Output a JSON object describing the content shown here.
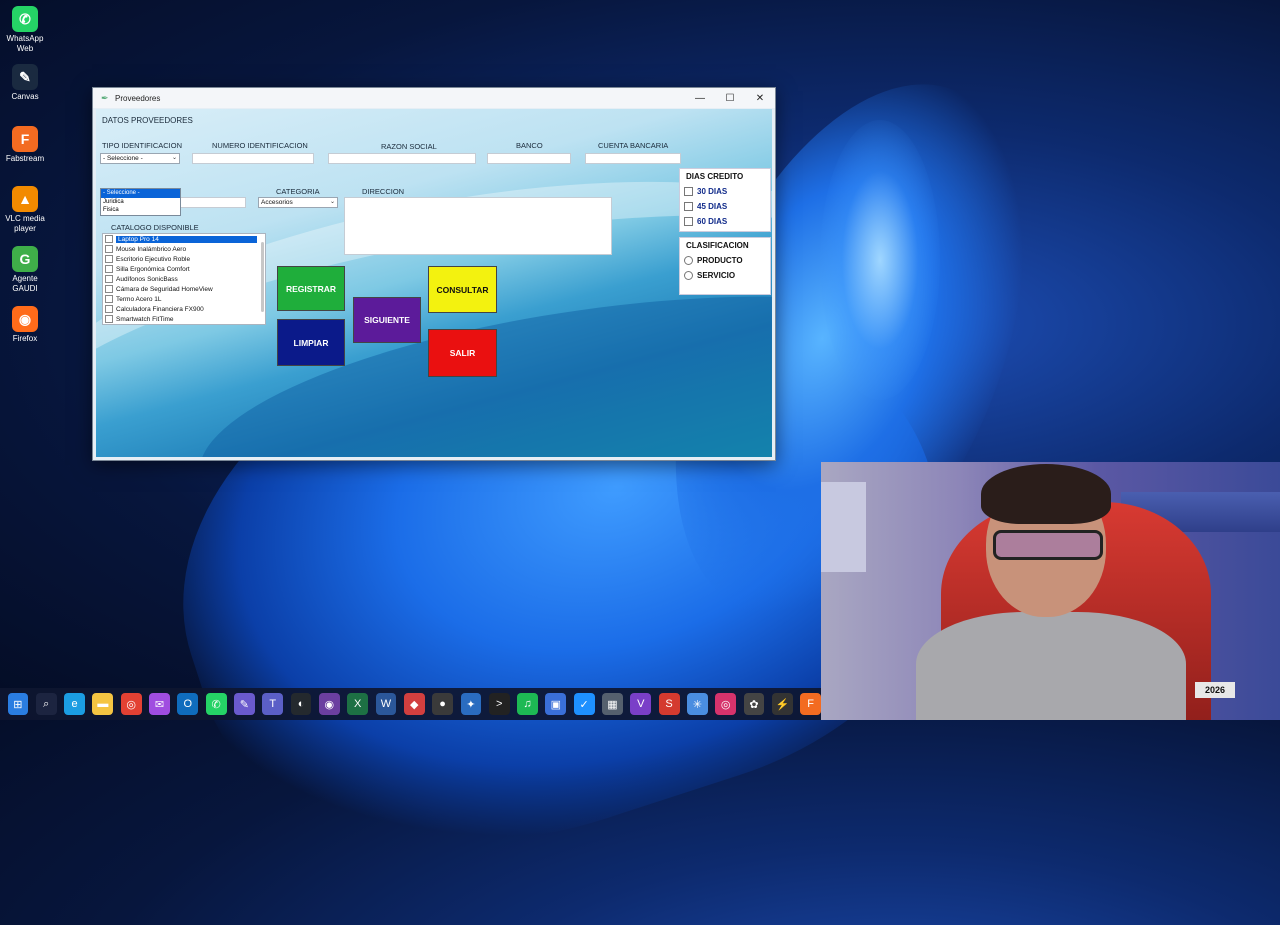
{
  "desktop_icons": [
    {
      "label": "WhatsApp Web",
      "icon": "whatsapp-icon",
      "color": "#25d366",
      "glyph": "✆"
    },
    {
      "label": "Canvas",
      "icon": "canvas-icon",
      "color": "#1a2a40",
      "glyph": "✎"
    },
    {
      "label": "Fabstream",
      "icon": "fabstream-icon",
      "color": "#f36b21",
      "glyph": "F"
    },
    {
      "label": "VLC media player",
      "icon": "vlc-icon",
      "color": "#f28a00",
      "glyph": "▲"
    },
    {
      "label": "Agente GAUDI",
      "icon": "gaudi-icon",
      "color": "#3fae49",
      "glyph": "G"
    },
    {
      "label": "Firefox",
      "icon": "firefox-icon",
      "color": "#ff6b1a",
      "glyph": "◉"
    }
  ],
  "window": {
    "title": "Proveedores",
    "controls": {
      "minimize": "—",
      "maximize": "☐",
      "close": "✕"
    }
  },
  "form": {
    "section_title": "DATOS PROVEEDORES",
    "labels": {
      "tipo_identificacion": "TIPO IDENTIFICACION",
      "numero_identificacion": "NUMERO IDENTIFICACION",
      "razon_social": "RAZON SOCIAL",
      "banco": "BANCO",
      "cuenta_bancaria": "CUENTA BANCARIA",
      "categoria": "CATEGORIA",
      "direccion": "DIRECCION",
      "catalogo": "CATALOGO DISPONIBLE"
    },
    "tipo_identificacion": {
      "selected": "- Seleccione -",
      "options": [
        "- Seleccione -",
        "Juridica",
        "Fisica"
      ]
    },
    "categoria": {
      "selected": "Accesorios"
    },
    "catalogo_items": [
      "Laptop Pro 14",
      "Mouse Inalámbrico Aero",
      "Escritorio Ejecutivo Roble",
      "Silla Ergonómica Comfort",
      "Audífonos SonicBass",
      "Cámara de Seguridad HomeView",
      "Termo Acero 1L",
      "Calculadora Financiera FX900",
      "Smartwatch FitTime"
    ],
    "buttons": {
      "registrar": "REGISTRAR",
      "limpiar": "LIMPIAR",
      "siguiente": "SIGUIENTE",
      "consultar": "CONSULTAR",
      "salir": "SALIR"
    },
    "dias_credito": {
      "title": "DIAS CREDITO",
      "options": [
        "30 DIAS",
        "45 DIAS",
        "60 DIAS"
      ]
    },
    "clasificacion": {
      "title": "CLASIFICACION",
      "options": [
        "PRODUCTO",
        "SERVICIO"
      ]
    }
  },
  "webcam": {
    "sign_text": "2026"
  },
  "taskbar": [
    {
      "icon": "windows-start-icon",
      "glyph": "⊞",
      "color": "#2a7de1"
    },
    {
      "icon": "search-icon",
      "glyph": "⌕",
      "color": "#1c2440"
    },
    {
      "icon": "edge-icon",
      "glyph": "e",
      "color": "#1b9de2"
    },
    {
      "icon": "file-explorer-icon",
      "glyph": "▬",
      "color": "#f5c542"
    },
    {
      "icon": "chrome-icon",
      "glyph": "◎",
      "color": "#e34133"
    },
    {
      "icon": "messenger-icon",
      "glyph": "✉",
      "color": "#a04de0"
    },
    {
      "icon": "outlook-icon",
      "glyph": "O",
      "color": "#0f6cbd"
    },
    {
      "icon": "whatsapp-icon",
      "glyph": "✆",
      "color": "#25d366"
    },
    {
      "icon": "paint-icon",
      "glyph": "✎",
      "color": "#6a5acd"
    },
    {
      "icon": "teams-icon",
      "glyph": "T",
      "color": "#5b5fc7"
    },
    {
      "icon": "github-icon",
      "glyph": "◐",
      "color": "#24292e"
    },
    {
      "icon": "obs-icon",
      "glyph": "◉",
      "color": "#6b3fa0"
    },
    {
      "icon": "excel-icon",
      "glyph": "X",
      "color": "#1d7044"
    },
    {
      "icon": "word-icon",
      "glyph": "W",
      "color": "#2b579a"
    },
    {
      "icon": "app-red-icon",
      "glyph": "◆",
      "color": "#d23f3f"
    },
    {
      "icon": "app-circle-icon",
      "glyph": "●",
      "color": "#3a3a3a"
    },
    {
      "icon": "app-tools-icon",
      "glyph": "✦",
      "color": "#2a6cc0"
    },
    {
      "icon": "terminal-icon",
      "glyph": ">",
      "color": "#222"
    },
    {
      "icon": "spotify-icon",
      "glyph": "♫",
      "color": "#1db954"
    },
    {
      "icon": "app-blue-icon",
      "glyph": "▣",
      "color": "#3a6fd8"
    },
    {
      "icon": "vscode-blue-icon",
      "glyph": "✓",
      "color": "#1e90ff"
    },
    {
      "icon": "app-grey-icon",
      "glyph": "▦",
      "color": "#55606e"
    },
    {
      "icon": "visual-studio-icon",
      "glyph": "V",
      "color": "#7a3fc8"
    },
    {
      "icon": "app-stripe-icon",
      "glyph": "S",
      "color": "#d43a2f"
    },
    {
      "icon": "app-ab-icon",
      "glyph": "✳",
      "color": "#4a8de0"
    },
    {
      "icon": "instagram-icon",
      "glyph": "◎",
      "color": "#d6336c"
    },
    {
      "icon": "chatgpt-icon",
      "glyph": "✿",
      "color": "#444"
    },
    {
      "icon": "app-bolt-icon",
      "glyph": "⚡",
      "color": "#333"
    },
    {
      "icon": "app-f-icon",
      "glyph": "F",
      "color": "#f36b21"
    }
  ]
}
